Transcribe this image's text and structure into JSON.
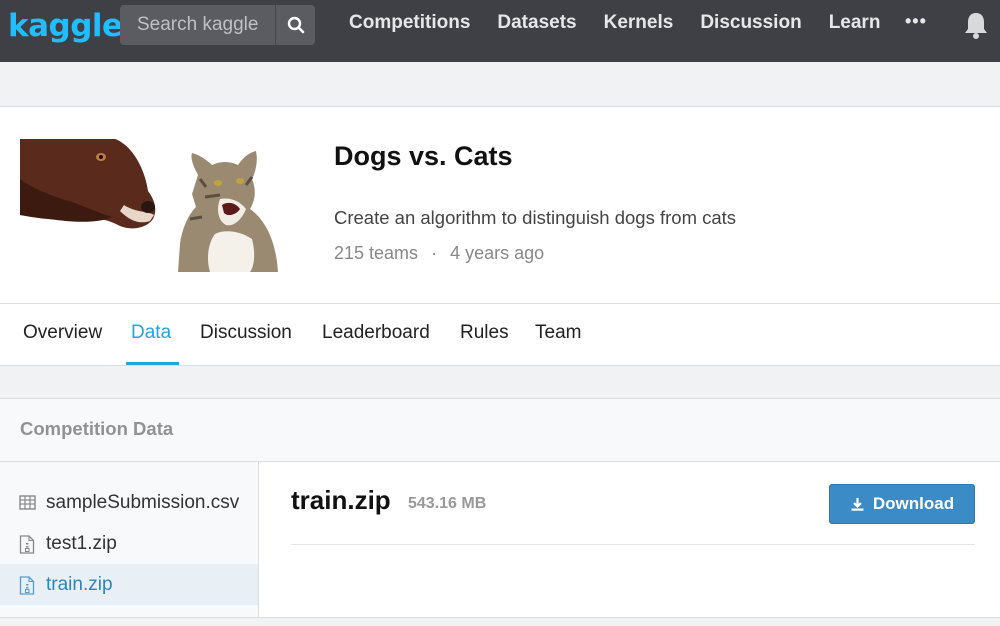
{
  "nav": {
    "logo": "kaggle",
    "search_placeholder": "Search kaggle",
    "links": [
      "Competitions",
      "Datasets",
      "Kernels",
      "Discussion",
      "Learn"
    ],
    "more": "•••",
    "icons": {
      "search": "search-icon",
      "bell": "bell-icon"
    }
  },
  "competition": {
    "title": "Dogs vs. Cats",
    "description": "Create an algorithm to distinguish dogs from cats",
    "teams": "215 teams",
    "separator": "·",
    "age": "4 years ago"
  },
  "tabs": [
    "Overview",
    "Data",
    "Discussion",
    "Leaderboard",
    "Rules",
    "Team"
  ],
  "active_tab": "Data",
  "data_section": {
    "title": "Competition Data",
    "files": [
      {
        "name": "sampleSubmission.csv",
        "icon": "table-icon"
      },
      {
        "name": "test1.zip",
        "icon": "zip-file-icon"
      },
      {
        "name": "train.zip",
        "icon": "zip-file-icon"
      }
    ],
    "selected_file": {
      "name": "train.zip",
      "size": "543.16 MB",
      "download_label": "Download"
    }
  },
  "colors": {
    "nav_bg": "#3f4045",
    "brand": "#20beff",
    "accent": "#20a5e0",
    "button": "#3a8bc6"
  }
}
